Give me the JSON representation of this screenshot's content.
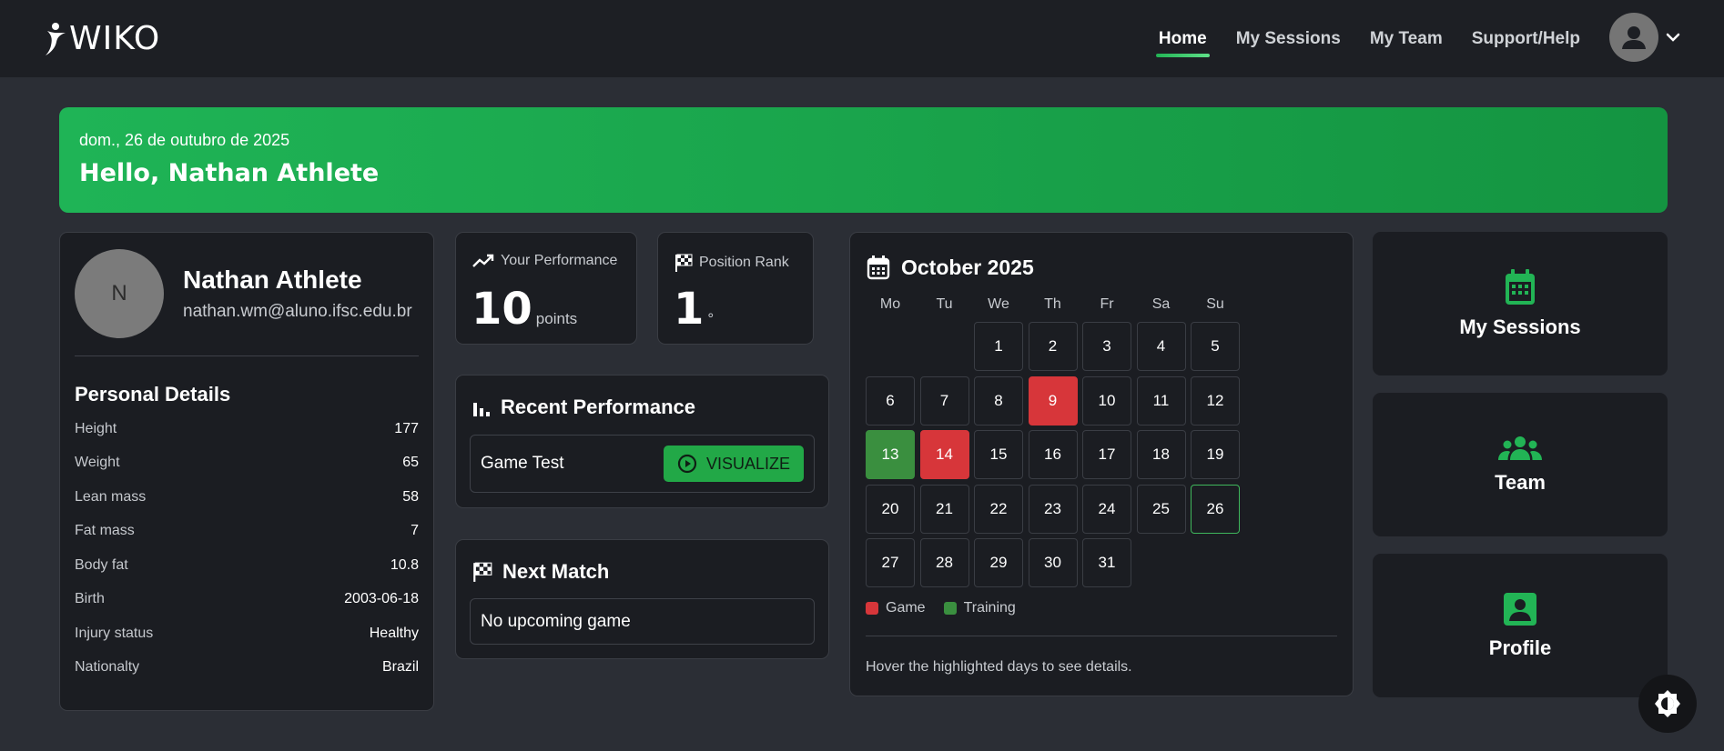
{
  "nav": {
    "logo": "WIKO",
    "links": [
      "Home",
      "My Sessions",
      "My Team",
      "Support/Help"
    ],
    "active": "Home"
  },
  "banner": {
    "date": "dom., 26 de outubro de 2025",
    "greeting": "Hello, Nathan Athlete"
  },
  "profile": {
    "initial": "N",
    "name": "Nathan Athlete",
    "email": "nathan.wm@aluno.ifsc.edu.br",
    "details_title": "Personal Details",
    "details": [
      {
        "label": "Height",
        "value": "177"
      },
      {
        "label": "Weight",
        "value": "65"
      },
      {
        "label": "Lean mass",
        "value": "58"
      },
      {
        "label": "Fat mass",
        "value": "7"
      },
      {
        "label": "Body fat",
        "value": "10.8"
      },
      {
        "label": "Birth",
        "value": "2003-06-18"
      },
      {
        "label": "Injury status",
        "value": "Healthy"
      },
      {
        "label": "Nationalty",
        "value": "Brazil"
      }
    ]
  },
  "stats": {
    "performance": {
      "label": "Your Performance",
      "value": "10",
      "unit": "points"
    },
    "rank": {
      "label": "Position Rank",
      "value": "1",
      "unit": "°"
    }
  },
  "recent": {
    "title": "Recent Performance",
    "item": "Game Test",
    "button": "VISUALIZE"
  },
  "next_match": {
    "title": "Next Match",
    "text": "No upcoming game"
  },
  "calendar": {
    "title": "October 2025",
    "weekdays": [
      "Mo",
      "Tu",
      "We",
      "Th",
      "Fr",
      "Sa",
      "Su"
    ],
    "days": [
      "1",
      "2",
      "3",
      "4",
      "5",
      "6",
      "7",
      "8",
      "9",
      "10",
      "11",
      "12",
      "13",
      "14",
      "15",
      "16",
      "17",
      "18",
      "19",
      "20",
      "21",
      "22",
      "23",
      "24",
      "25",
      "26",
      "27",
      "28",
      "29",
      "30",
      "31"
    ],
    "first_weekday_index": 2,
    "games": [
      9,
      14
    ],
    "trainings": [
      13
    ],
    "today": 26,
    "legend": {
      "game": "Game",
      "training": "Training"
    },
    "hint": "Hover the highlighted days to see details.",
    "colors": {
      "game": "#d7363a",
      "training": "#3a8f3f",
      "accent": "#22b455"
    }
  },
  "quick_links": [
    "My Sessions",
    "Team",
    "Profile"
  ]
}
